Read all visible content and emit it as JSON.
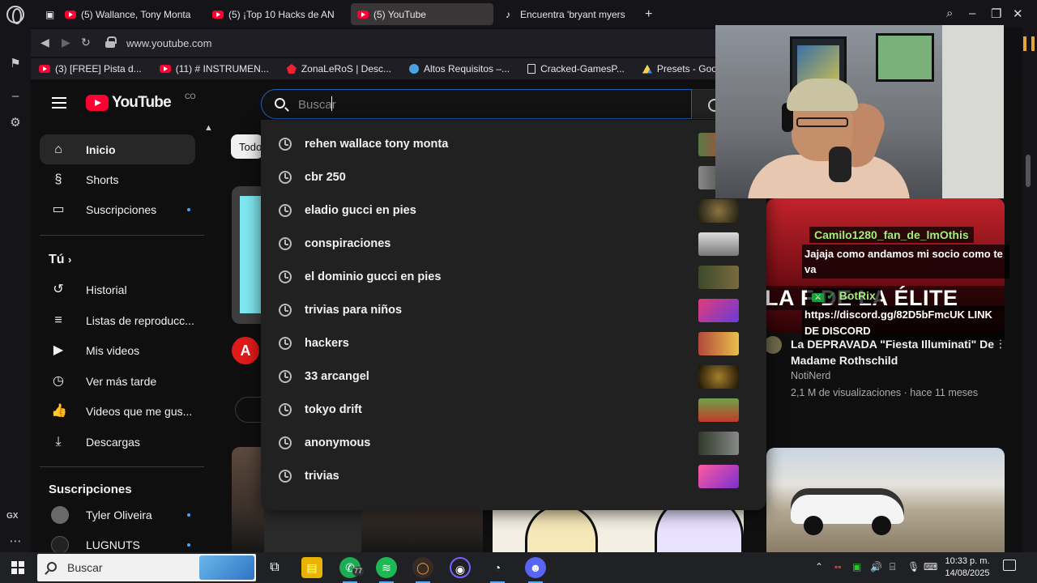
{
  "tabs": [
    {
      "label": "(5) Wallance, Tony Monta",
      "icon": "youtube-icon"
    },
    {
      "label": "(5) ¡Top 10 Hacks de AN",
      "icon": "youtube-icon"
    },
    {
      "label": "(5) YouTube",
      "icon": "youtube-icon",
      "active": true
    },
    {
      "label": "Encuentra 'bryant myers",
      "icon": "tiktok-icon"
    }
  ],
  "address": {
    "url": "www.youtube.com"
  },
  "bookmarks": [
    {
      "label": "(3) [FREE] Pista d...",
      "icon": "youtube-icon"
    },
    {
      "label": "(11) # INSTRUMEN...",
      "icon": "youtube-icon"
    },
    {
      "label": "ZonaLeRoS | Desc...",
      "icon": "zonaleros-icon"
    },
    {
      "label": "Altos Requisitos –...",
      "icon": "altos-icon"
    },
    {
      "label": "Cracked-GamesP...",
      "icon": "document-icon"
    },
    {
      "label": "Presets - Google...",
      "icon": "google-drive-icon"
    }
  ],
  "youtube": {
    "logo_text": "YouTube",
    "country": "CO",
    "search_placeholder": "Buscar",
    "chip_label": "Todo"
  },
  "sidebar": {
    "main": [
      {
        "label": "Inicio",
        "icon": "home-icon",
        "active": true
      },
      {
        "label": "Shorts",
        "icon": "shorts-icon"
      },
      {
        "label": "Suscripciones",
        "icon": "subscriptions-icon",
        "dot": true
      }
    ],
    "you_title": "Tú",
    "you": [
      {
        "label": "Historial",
        "icon": "history-icon"
      },
      {
        "label": "Listas de reproducc...",
        "icon": "playlists-icon"
      },
      {
        "label": "Mis videos",
        "icon": "my-videos-icon"
      },
      {
        "label": "Ver más tarde",
        "icon": "watch-later-icon"
      },
      {
        "label": "Videos que me gus...",
        "icon": "like-icon"
      },
      {
        "label": "Descargas",
        "icon": "downloads-icon"
      }
    ],
    "subs_title": "Suscripciones",
    "subs": [
      {
        "label": "Tyler Oliveira",
        "dot": true
      },
      {
        "label": "LUGNUTS",
        "dot": true
      }
    ]
  },
  "suggestions": [
    "rehen wallace tony monta",
    "cbr 250",
    "eladio gucci en pies",
    "conspiraciones",
    "el dominio gucci en pies",
    "trivias para niños",
    "hackers",
    "33 arcangel",
    "tokyo drift",
    "anonymous",
    "trivias"
  ],
  "video": {
    "thumb_text": "LA F DE LA ÉLITE",
    "title": "La DEPRAVADA \"Fiesta Illuminati\" De Madame Rothschild",
    "channel": "NotiNerd",
    "meta": "2,1 M de visualizaciones · hace 11 meses"
  },
  "chat": {
    "user1": "Camilo1280_fan_de_lmOthis",
    "msg1": "Jajaja como andamos mi socio como te va",
    "user2": "BotRix",
    "msg2": "https://discord.gg/82D5bFmcUK LINK DE DISCORD"
  },
  "taskbar": {
    "search_label": "Buscar",
    "whatsapp_badge": "77",
    "time": "10:33 p. m.",
    "date": "14/08/2025"
  },
  "gx": {
    "label": "GX"
  },
  "colors": {
    "youtube_red": "#ff0033",
    "accent_blue": "#3ea6ff",
    "chat_green": "#9ff07a"
  }
}
